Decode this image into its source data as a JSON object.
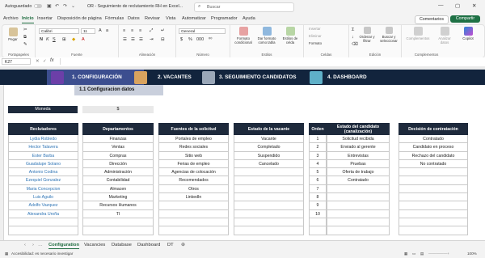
{
  "titlebar": {
    "autosave_label": "Autoguardado",
    "autosave_state": "off",
    "document_title": "OR - Seguimiento de reclutamiento RH en Excel...",
    "search_placeholder": "Buscar",
    "minimize": "—",
    "maximize": "▢",
    "close": "✕"
  },
  "menu": {
    "tabs": [
      "Archivo",
      "Inicio",
      "Insertar",
      "Disposición de página",
      "Fórmulas",
      "Datos",
      "Revisar",
      "Vista",
      "Automatizar",
      "Programador",
      "Ayuda"
    ],
    "active_tab": "Inicio",
    "comments_label": "Comentarios",
    "share_label": "Compartir"
  },
  "ribbon": {
    "clipboard": {
      "label": "Portapapeles",
      "paste": "Pegar"
    },
    "font": {
      "label": "Fuente",
      "font_name": "Calibri",
      "font_size": "11"
    },
    "alignment": {
      "label": "Alineación"
    },
    "number": {
      "label": "Número",
      "format": "General"
    },
    "styles": {
      "label": "Estilos",
      "conditional": "Formato condicional",
      "as_table": "Dar formato como tabla",
      "cell_styles": "Estilos de celda"
    },
    "cells": {
      "label": "Celdas",
      "insert": "Insertar",
      "delete": "Eliminar",
      "format": "Formato"
    },
    "editing": {
      "label": "Edición",
      "sort": "Ordenar y filtrar",
      "find": "Buscar y seleccionar"
    },
    "addins": {
      "label": "Complementos",
      "addins": "Complementos",
      "analyze": "Analizar datos",
      "copilot": "Copilot"
    }
  },
  "formula_bar": {
    "name_box": "K27",
    "fx": "fx",
    "value": ""
  },
  "nav": {
    "items": [
      "1. CONFIGURACIÓN",
      "2. VACANTES",
      "3. SEGUIMIENTO CANDIDATOS",
      "4. DASHBOARD"
    ],
    "active": "1. CONFIGURACIÓN",
    "subtab": "1.1 Configuracion datos"
  },
  "moneda": {
    "label": "Moneda",
    "value": "$"
  },
  "tables": {
    "reclutadores": {
      "header": "Reclutadores",
      "rows": [
        "Lydia Robledo",
        "Hector Talavera",
        "Ester Barba",
        "Guadalupe Solano",
        "Antonio Codina",
        "Ezequiel Gonzalez",
        "Maria Concepcion",
        "Luis Aguilo",
        "Adolfo Vazquez",
        "Alexandra Uroña",
        "",
        ""
      ]
    },
    "departamentos": {
      "header": "Departamentos",
      "rows": [
        "Finanzas",
        "Ventas",
        "Compras",
        "Dirección",
        "Administración",
        "Contabilidad",
        "Almacen",
        "Marketing",
        "Recursos Humanos",
        "TI",
        "",
        ""
      ]
    },
    "fuentes": {
      "header": "Fuentes de la solicitud",
      "rows": [
        "Portales de empleo",
        "Redes sociales",
        "Sitio web",
        "Ferias de empleo",
        "Agencias de colocación",
        "Recomendados",
        "Otros",
        "LinkedIn",
        "",
        "",
        "",
        ""
      ]
    },
    "estado_vacante": {
      "header": "Estado de la vacante",
      "rows": [
        "Vacante",
        "Completado",
        "Suspendido",
        "Cancelado",
        "",
        "",
        "",
        "",
        "",
        "",
        "",
        ""
      ]
    },
    "estado_candidato": {
      "header_orden": "Orden",
      "header": "Estado del candidato (canalización)",
      "orden": [
        "1",
        "2",
        "3",
        "4",
        "5",
        "6",
        "7",
        "8",
        "9",
        "10",
        "",
        ""
      ],
      "rows": [
        "Solicitud recibida",
        "Enviado al gerente",
        "Entrevistas",
        "Pruebas",
        "Oferta de trabajo",
        "Contratado",
        "",
        "",
        "",
        "",
        "",
        ""
      ]
    },
    "decision": {
      "header": "Decisión de contratación",
      "rows": [
        "Contratado",
        "Candidato en proceso",
        "Rechazo del candidato",
        "No contratado",
        "",
        "",
        "",
        "",
        "",
        "",
        "",
        ""
      ]
    }
  },
  "sheet_tabs": [
    "Configuration",
    "Vacancies",
    "Database",
    "Dashboard",
    "DT"
  ],
  "active_sheet": "Configuration",
  "status": {
    "accessibility": "Accesibilidad: es necesario investigar",
    "zoom": "100%"
  }
}
